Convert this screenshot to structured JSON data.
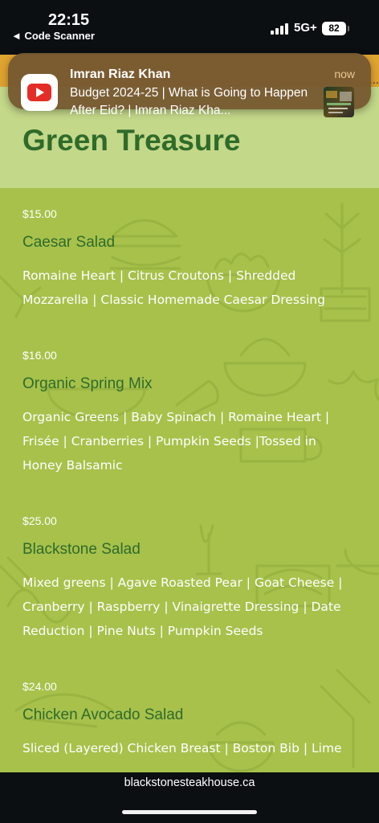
{
  "status_bar": {
    "time": "22:15",
    "back_link": "◄ Code Scanner",
    "network": "5G+",
    "battery": "82"
  },
  "notification": {
    "app": "youtube-icon",
    "title": "Imran Riaz Khan",
    "body": "Budget 2024-25 | What is Going to Happen After Eid? | Imran Riaz Kha...",
    "time": "now"
  },
  "page": {
    "strip_ellipsis": "...",
    "title": "Green Treasure",
    "items": [
      {
        "price": "$15.00",
        "name": "Caesar Salad",
        "description": "Romaine Heart | Citrus Croutons | Shredded Mozzarella | Classic Homemade Caesar Dressing"
      },
      {
        "price": "$16.00",
        "name": "Organic Spring Mix",
        "description": "Organic Greens | Baby Spinach | Romaine Heart | Frisée | Cranberries | Pumpkin Seeds |Tossed in Honey Balsamic"
      },
      {
        "price": "$25.00",
        "name": "Blackstone Salad",
        "description": "Mixed greens | Agave Roasted Pear | Goat Cheese | Cranberry | Raspberry | Vinaigrette Dressing | Date Reduction | Pine Nuts | Pumpkin Seeds"
      },
      {
        "price": "$24.00",
        "name": "Chicken Avocado Salad",
        "description": "Sliced (Layered) Chicken Breast | Boston Bib | Lime"
      }
    ]
  },
  "browser": {
    "url": "blackstonesteakhouse.ca"
  },
  "colors": {
    "page_background": "#a7c14b",
    "title_green": "#2f6b2a",
    "title_band": "#c4d889",
    "orange_strip": "#e0a430",
    "notification_background": "#785a32"
  }
}
